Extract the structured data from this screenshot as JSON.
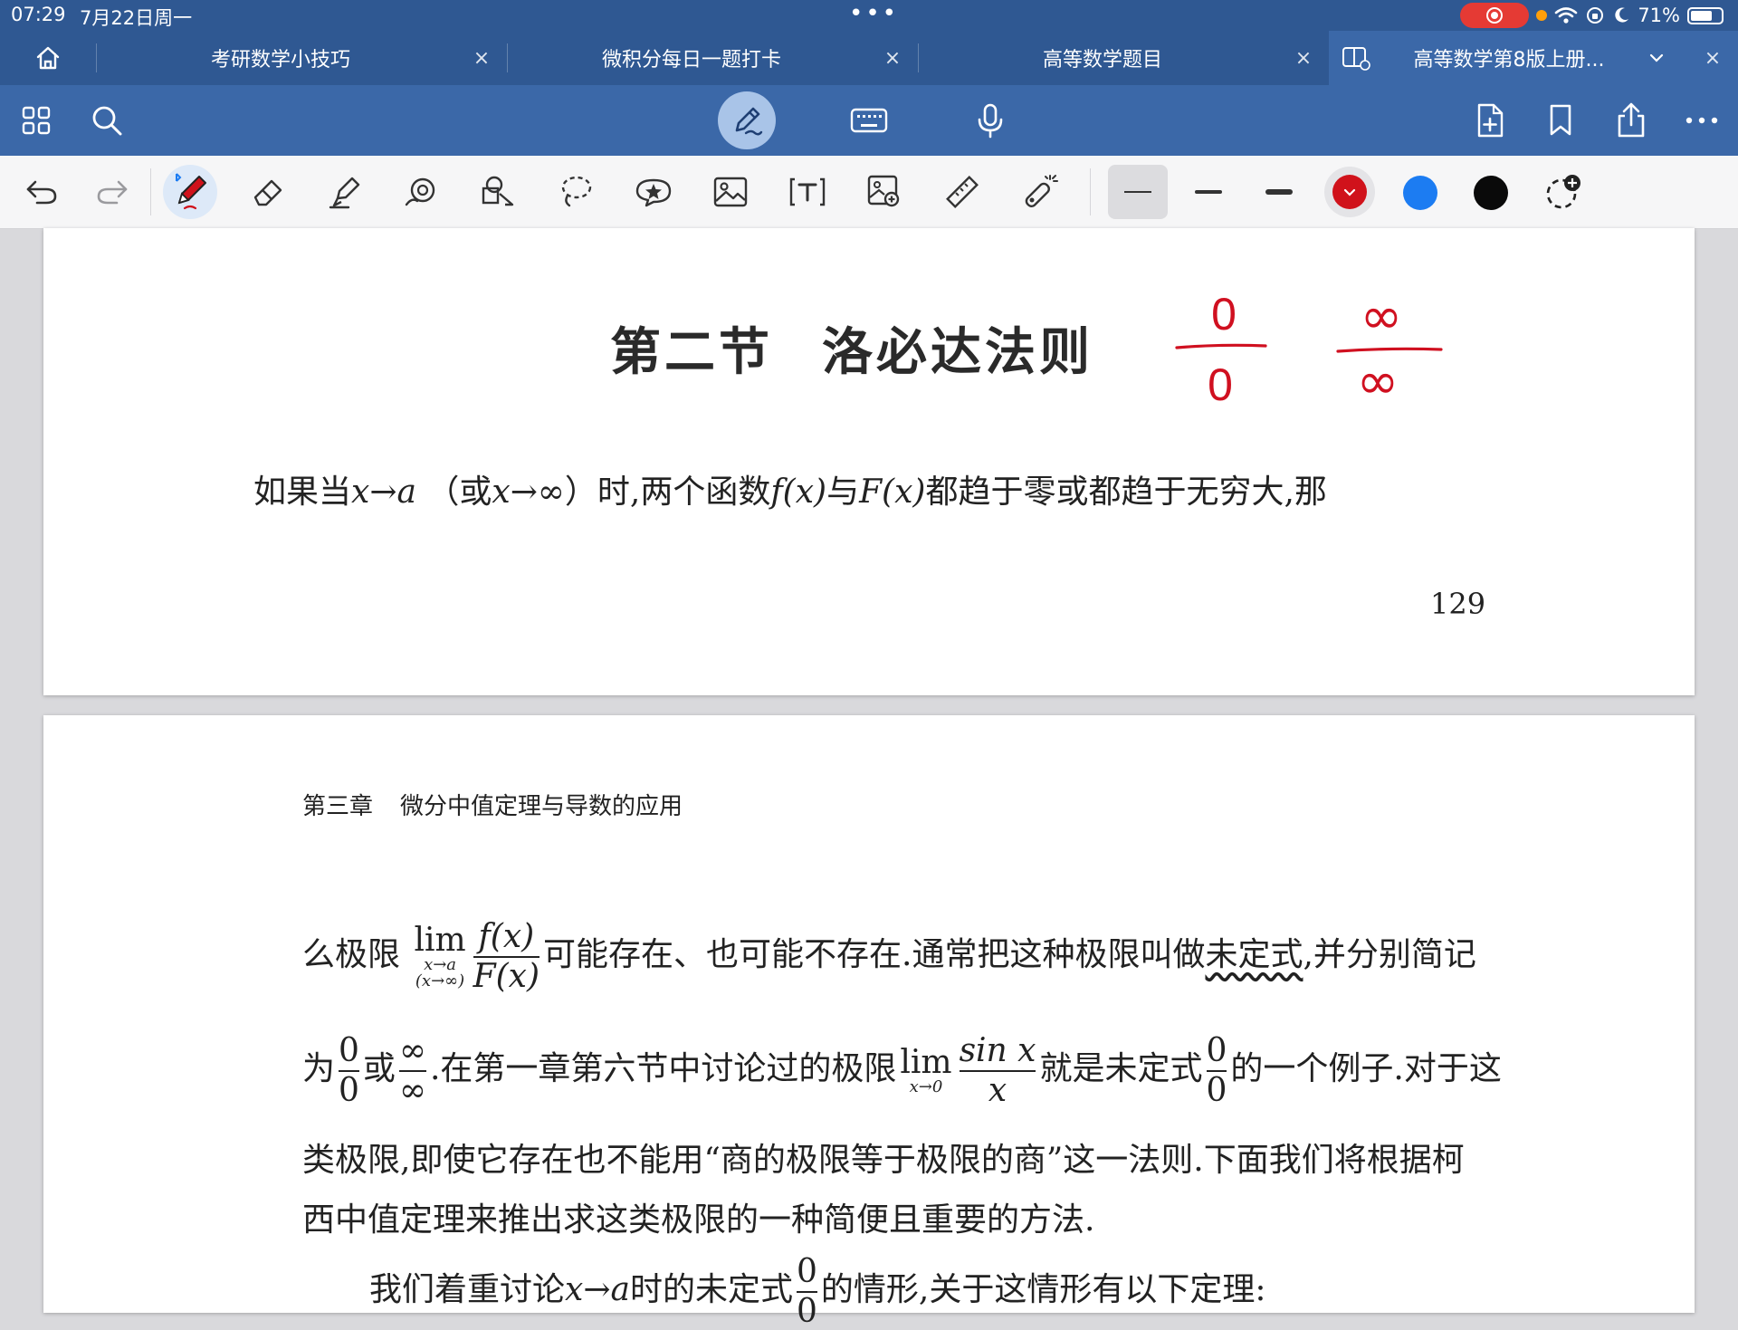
{
  "status_bar": {
    "time": "07:29",
    "date": "7月22日周一",
    "battery": "71%",
    "battery_level": 0.71
  },
  "tabs": [
    {
      "label": "考研数学小技巧",
      "close": "×",
      "active": false
    },
    {
      "label": "微积分每日一题打卡",
      "close": "×",
      "active": false
    },
    {
      "label": "高等数学题目",
      "close": "×",
      "active": false
    },
    {
      "label": "高等数学第8版上册...",
      "close": "×",
      "active": true
    }
  ],
  "icons": {
    "home": "home-icon",
    "grid": "grid-icon",
    "search": "search-icon",
    "pen_mode": "pen-mode-icon",
    "keyboard": "keyboard-icon",
    "microphone": "microphone-icon",
    "add_page": "add-page-icon",
    "bookmark": "bookmark-icon",
    "share": "share-icon",
    "more": "more-icon"
  },
  "drawing_tools": [
    "undo",
    "redo",
    "pen",
    "eraser",
    "highlighter",
    "shape",
    "shapes-recognize",
    "lasso",
    "sticker",
    "image",
    "text",
    "camera-image",
    "ruler",
    "laser-pointer"
  ],
  "pen_colors": {
    "red": "#d0121b",
    "blue": "#1c7cf2",
    "black": "#0a0a0a",
    "ink_red": "#d01020"
  },
  "page1": {
    "title_part1": "第二节",
    "title_part2": "洛必达法则",
    "line1_a": "如果当",
    "line1_x1": "x→a",
    "line1_b": "（或",
    "line1_x2": "x→∞",
    "line1_c": "）时,两个函数",
    "line1_f": "f(x)",
    "line1_d": "与",
    "line1_F": "F(x)",
    "line1_e": "都趋于零或都趋于无穷大,那",
    "page_number": "129",
    "annotation_fraction1": {
      "num": "0",
      "den": "0"
    },
    "annotation_fraction2": {
      "num": "∞",
      "den": "∞"
    }
  },
  "page2": {
    "running_head_chapter": "第三章",
    "running_head_title": "微分中值定理与导数的应用",
    "l1_a": "么极限",
    "l1_lim": "lim",
    "l1_lim_sub1": "x→a",
    "l1_lim_sub2": "(x→∞)",
    "l1_frac_num": "f(x)",
    "l1_frac_den": "F(x)",
    "l1_b": "可能存在、也可能不存在.通常把这种极限叫做",
    "l1_term": "未定式",
    "l1_c": ",并分别简记",
    "l2_a": "为",
    "l2_f1_num": "0",
    "l2_f1_den": "0",
    "l2_b": "或",
    "l2_f2_num": "∞",
    "l2_f2_den": "∞",
    "l2_c": ".在第一章第六节中讨论过的极限",
    "l2_lim": "lim",
    "l2_lim_sub": "x→0",
    "l2_f3_num": "sin x",
    "l2_f3_den": "x",
    "l2_d": "就是未定式",
    "l2_f4_num": "0",
    "l2_f4_den": "0",
    "l2_e": "的一个例子.对于这",
    "l3": "类极限,即使它存在也不能用“商的极限等于极限的商”这一法则.下面我们将根据柯",
    "l4": "西中值定理来推出求这类极限的一种简便且重要的方法.",
    "l5_a": "我们着重讨论",
    "l5_x": "x→a",
    "l5_b": "时的未定式",
    "l5_f_num": "0",
    "l5_f_den": "0",
    "l5_c": "的情形,关于这情形有以下定理:"
  }
}
